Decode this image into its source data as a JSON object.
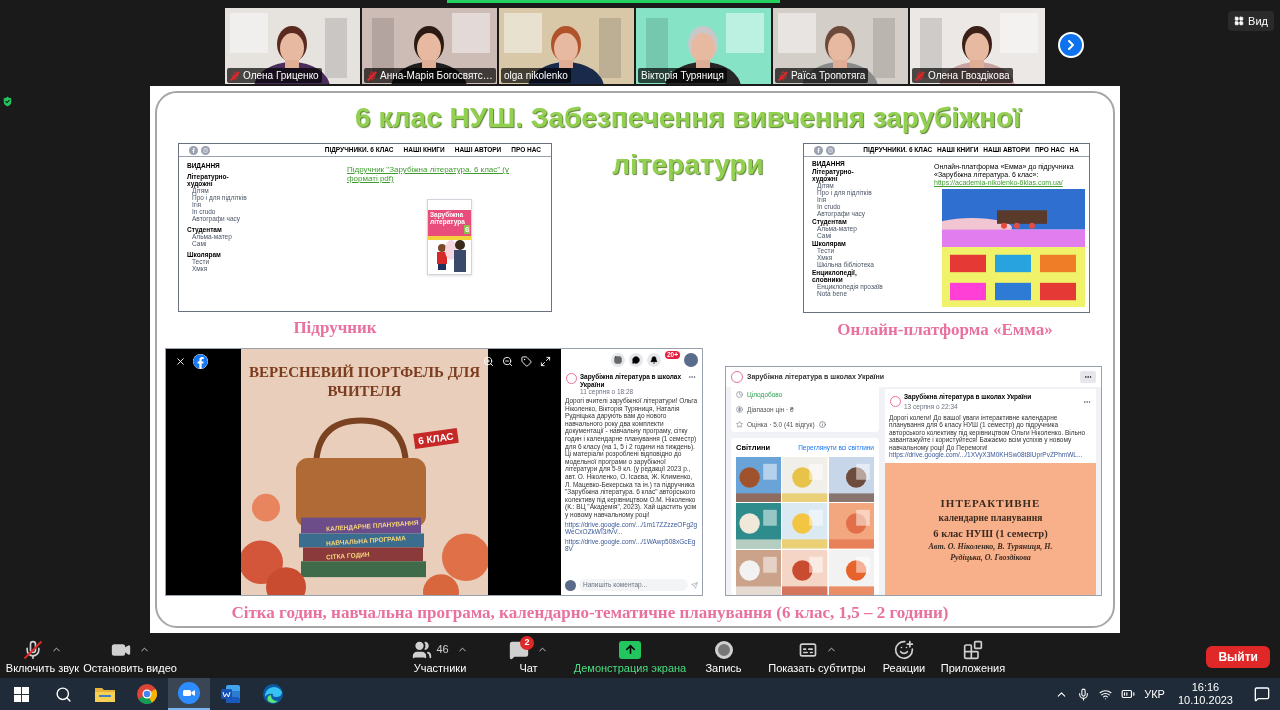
{
  "participants": [
    {
      "name": "Олена Гриценко",
      "muted": true
    },
    {
      "name": "Анна-Марія Богосвятс…",
      "muted": true
    },
    {
      "name": "olga nikolenko",
      "muted": false
    },
    {
      "name": "Вікторія Туряниця",
      "muted": false
    },
    {
      "name": "Раїса Тропотяга",
      "muted": true
    },
    {
      "name": "Олена Гвоздікова",
      "muted": true
    }
  ],
  "view_button": "Вид",
  "slide": {
    "title_lines": [
      "6 клас НУШ. Забезпечення вивчення зарубіжної",
      "літератури"
    ],
    "textbook_site": {
      "nav": [
        "ПІДРУЧНИКИ. 6 КЛАС",
        "НАШІ КНИГИ",
        "НАШІ АВТОРИ",
        "ПРО НАС"
      ],
      "sidebar": [
        {
          "heading": "ВИДАННЯ"
        },
        {
          "heading": "Літературно-художні",
          "items": [
            "Дітям",
            "Про і для підлітків",
            "Ігія",
            "In crudo",
            "Автографи часу"
          ]
        },
        {
          "heading": "Студентам",
          "items": [
            "Альма-матер",
            "Самі"
          ]
        },
        {
          "heading": "Школярам",
          "items": [
            "Тести",
            "Хмкя"
          ]
        }
      ],
      "link": "Підручник \"Зарубіжна література. 6 клас\" (у форматі pdf)",
      "cover": {
        "title": "Зарубіжна література",
        "grade": "6"
      }
    },
    "textbook_caption": "Підручник",
    "platform_site": {
      "nav": [
        "ПІДРУЧНИКИ. 6 КЛАС",
        "НАШІ КНИГИ",
        "НАШІ АВТОРИ",
        "ПРО НАС",
        "НА"
      ],
      "sidebar": [
        {
          "heading": "ВИДАННЯ"
        },
        {
          "heading": "Літературно-художні",
          "items": [
            "Дітям",
            "Про і для підлітків",
            "Ігія",
            "In crudo",
            "Автографи часу"
          ]
        },
        {
          "heading": "Студентам",
          "items": [
            "Альма-матер",
            "Самі"
          ]
        },
        {
          "heading": "Школярам",
          "items": [
            "Тести",
            "Хмкя",
            "Шкільна бібліотека"
          ]
        },
        {
          "heading": "Енциклопедії, словники",
          "items": [
            "Енциклопедія прозаїв",
            "Nota bene"
          ]
        }
      ],
      "intro": "Онлайн-платформа «Емма» до підручника «Зарубіжна література. 6 клас»:",
      "link": "https://academia-nikolenko-6klas.com.ua/"
    },
    "platform_caption": "Онлайн-платформа «Емма»",
    "fb_viewer": {
      "photo_title": "ВЕРЕСНЕВИЙ ПОРТФЕЛЬ ДЛЯ ВЧИТЕЛЯ",
      "photo_badge": "6 КЛАС",
      "book_spines": [
        "КАЛЕНДАРНЕ ПЛАНУВАННЯ",
        "НАВЧАЛЬНА ПРОГРАМА",
        "СІТКА ГОДИН"
      ],
      "notifications_badge": "20+",
      "post": {
        "author": "Зарубіжна література в школах України",
        "time": "11 серпня о 18:28",
        "text": "Дорогі вчителі зарубіжної літератури! Ольга Ніколенко, Вікторія Туряниця, Наталія Рудніцька дарують вам до нового навчального року два комплекти документації - навчальну програму, сітку годин і календарне планування (1 семестр) для 6 класу (на 1, 5 і 2 години на тиждень). Ці матеріали розроблені відповідно до модельної програми о зарубіжної літератури для 5-9 кл. (у редакції 2023 р., авт. О. Ніколенко, О. Ісаєва, Ж. Клименко, Л. Мацевко-Бекерська та ін.) та підручника \"Зарубіжна література. 6 клас\" авторського колективу під керівництвом О.М. Ніколенко (К.: ВЦ \"Академія\", 2023). Хай щастить усім у новому навчальному році!",
        "links": [
          "https://drive.google.com/.../1m17ZZzzeOFg2gWeCxOZkWI3/fvV...",
          "https://drive.google.com/.../1WAwp508xGcEg8V"
        ],
        "comment_placeholder": "Напишіть коментар..."
      }
    },
    "fb_page": {
      "title": "Зарубіжна література в школах України",
      "info": [
        {
          "kind": "hours",
          "text": "Цілодобово"
        },
        {
          "kind": "price",
          "text": "Діапазон цін · ₴"
        },
        {
          "kind": "rating",
          "text": "Оцінка · 5.0 (41 відгук)"
        }
      ],
      "photos_heading": "Світлини",
      "photos_link": "Переглянути всі світлини",
      "post": {
        "author": "Зарубіжна література в школах України",
        "time": "13 серпня о 22:34",
        "text": "Дорогі колеги! До вашої уваги інтерактивне календарне планування для 6 класу НУШ (1 семестр) до підручника авторського колективу під керівництвом Ольги Ніколенко. Вільно завантажуйте і користуйтеся! Бажаємо всім успіхів у новому навчальному році! До Перемоги!",
        "link": "https://drive.google.com/.../1XVyX3M0KHSw08t8IUprPvZPhmWL...",
        "card": {
          "title": "ІНТЕРАКТИВНЕ",
          "subtitle": "календарне планування",
          "grade": "6 клас НУШ (1 семестр)",
          "authors": "Авт. О. Ніколенко, В. Туряниця, Н. Рудіцька, О. Гвоздікова"
        }
      }
    },
    "bottom_caption": "Сітка годин, навчальна програма, календарно-тематичне планування (6 клас, 1,5 – 2 години)"
  },
  "toolbar": {
    "left": [
      {
        "kind": "audio",
        "label": "Включить звук",
        "caret": true
      },
      {
        "kind": "video",
        "label": "Остановить видео",
        "caret": true
      }
    ],
    "center": [
      {
        "kind": "participants",
        "label": "Участники",
        "count": "46",
        "caret": true
      },
      {
        "kind": "chat",
        "label": "Чат",
        "badge": "2",
        "caret": true
      },
      {
        "kind": "share",
        "label": "Демонстрация экрана"
      },
      {
        "kind": "record",
        "label": "Запись"
      },
      {
        "kind": "captions",
        "label": "Показать субтитры",
        "caret": true
      },
      {
        "kind": "reactions",
        "label": "Реакции"
      },
      {
        "kind": "apps",
        "label": "Приложения"
      }
    ],
    "leave": "Выйти"
  },
  "taskbar": {
    "apps": [
      {
        "kind": "start",
        "selected": false
      },
      {
        "kind": "search",
        "selected": false
      },
      {
        "kind": "explorer",
        "selected": false
      },
      {
        "kind": "chrome",
        "selected": false
      },
      {
        "kind": "zoom",
        "selected": true
      },
      {
        "kind": "word",
        "selected": false
      },
      {
        "kind": "edge",
        "selected": false
      }
    ],
    "language": "УКР",
    "time": "16:16",
    "date": "10.10.2023"
  }
}
